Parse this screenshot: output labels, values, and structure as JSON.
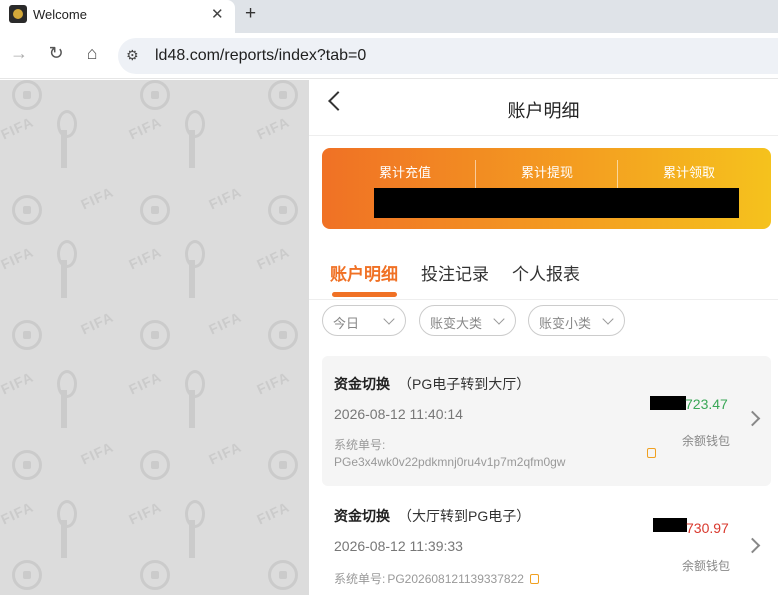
{
  "browser": {
    "tab_title": "Welcome",
    "url": "ld48.com/reports/index?tab=0"
  },
  "page": {
    "title": "账户明细",
    "background_watermark": "FIFA"
  },
  "stats": [
    {
      "label": "累计充值"
    },
    {
      "label": "累计提现"
    },
    {
      "label": "累计领取"
    }
  ],
  "tabs": [
    {
      "label": "账户明细",
      "active": true
    },
    {
      "label": "投注记录",
      "active": false
    },
    {
      "label": "个人报表",
      "active": false
    }
  ],
  "filters": [
    {
      "label": "今日"
    },
    {
      "label": "账变大类"
    },
    {
      "label": "账变小类"
    }
  ],
  "records": [
    {
      "type": "资金切换",
      "detail": "（PG电子转到大厅）",
      "time": "2026-08-12 11:40:14",
      "order_label": "系统单号:",
      "order_no": "PGe3x4wk0v22pdkmnj0ru4v1p7m2qfm0gw",
      "amount": "723.47",
      "amount_color": "#3aa757",
      "wallet": "余额钱包"
    },
    {
      "type": "资金切换",
      "detail": "（大厅转到PG电子）",
      "time": "2026-08-12 11:39:33",
      "order_label": "系统单号:",
      "order_no": "PG202608121139337822",
      "amount": "730.97",
      "amount_color": "#d9382d",
      "wallet": "余额钱包"
    }
  ]
}
